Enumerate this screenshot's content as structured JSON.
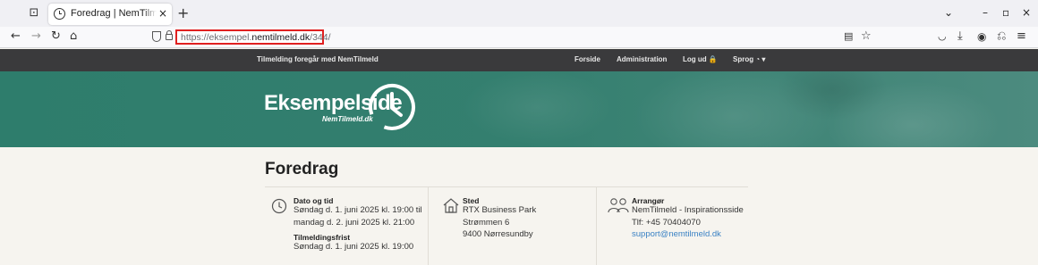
{
  "browser": {
    "tab_title": "Foredrag | NemTilmeld - Inspirationsside",
    "tab_close": "×",
    "new_tab": "+",
    "url_prefix": "https://eksempel.",
    "url_host": "nemtilmeld.dk",
    "url_path": "/344/",
    "window_controls": [
      "⌄",
      "–",
      "▫",
      "×"
    ],
    "nav_icons": [
      "back-icon",
      "forward-icon",
      "reload-icon",
      "home-icon"
    ],
    "toolbar_icons": [
      "reader-view-icon",
      "bookmark-star-icon",
      "pocket-icon",
      "downloads-icon",
      "account-icon",
      "extensions-icon",
      "menu-icon"
    ]
  },
  "site": {
    "tagline": "Tilmelding foregår med NemTilmeld",
    "menu": {
      "home": "Forside",
      "admin": "Administration",
      "logout": "Log ud 🔒",
      "language": "Sprog ◔ ▾"
    },
    "logo": {
      "name": "Eksempelside",
      "sub": "NemTilmeld.dk"
    }
  },
  "event": {
    "title": "Foredrag",
    "date": {
      "heading": "Dato og tid",
      "line1": "Søndag d. 1. juni 2025 kl. 19:00 til",
      "line2": "mandag d. 2. juni 2025 kl. 21:00",
      "deadline_heading": "Tilmeldingsfrist",
      "deadline": "Søndag d. 1. juni 2025 kl. 19:00"
    },
    "place": {
      "heading": "Sted",
      "line1": "RTX Business Park",
      "line2": "Strømmen 6",
      "line3": "9400 Nørresundby"
    },
    "organizer": {
      "heading": "Arrangør",
      "name": "NemTilmeld - Inspirationsside",
      "phone": "Tlf: +45 70404070",
      "email": "support@nemtilmeld.dk"
    }
  },
  "colors": {
    "accent": "#2e7d6c",
    "topbar": "#3a3a3c",
    "link": "#3b82c4",
    "url_highlight": "#e02020"
  }
}
